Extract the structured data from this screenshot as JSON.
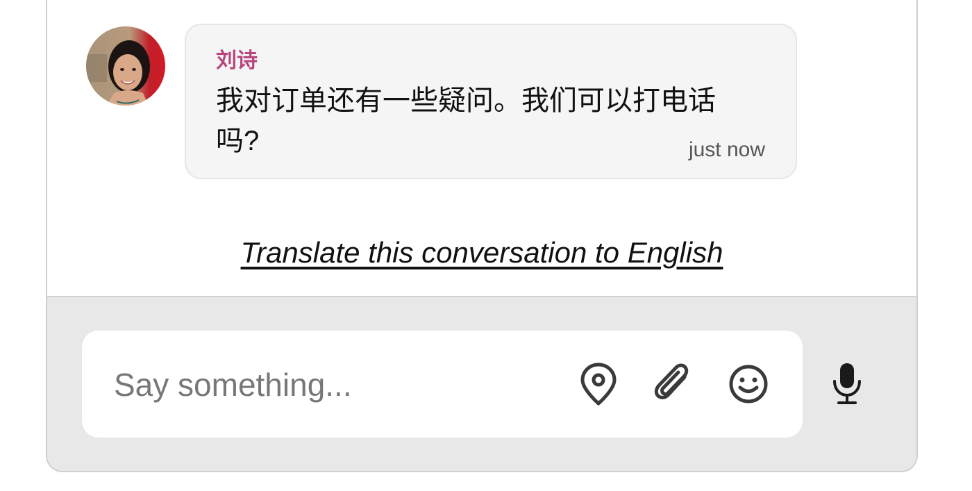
{
  "conversation": {
    "message": {
      "sender": "刘诗",
      "text": "我对订单还有一些疑问。我们可以打电话吗?",
      "timestamp": "just now",
      "avatar_icon": "user-avatar-photo"
    },
    "translate_link": "Translate this conversation to English"
  },
  "composer": {
    "placeholder": "Say something...",
    "value": "",
    "icons": [
      "location-pin-icon",
      "paperclip-icon",
      "smiley-icon",
      "microphone-icon"
    ]
  },
  "colors": {
    "sender_name": "#b9457e",
    "bubble_bg": "#f5f5f5",
    "composer_bg": "#e8e8e8",
    "icon": "#3a3a3a"
  }
}
